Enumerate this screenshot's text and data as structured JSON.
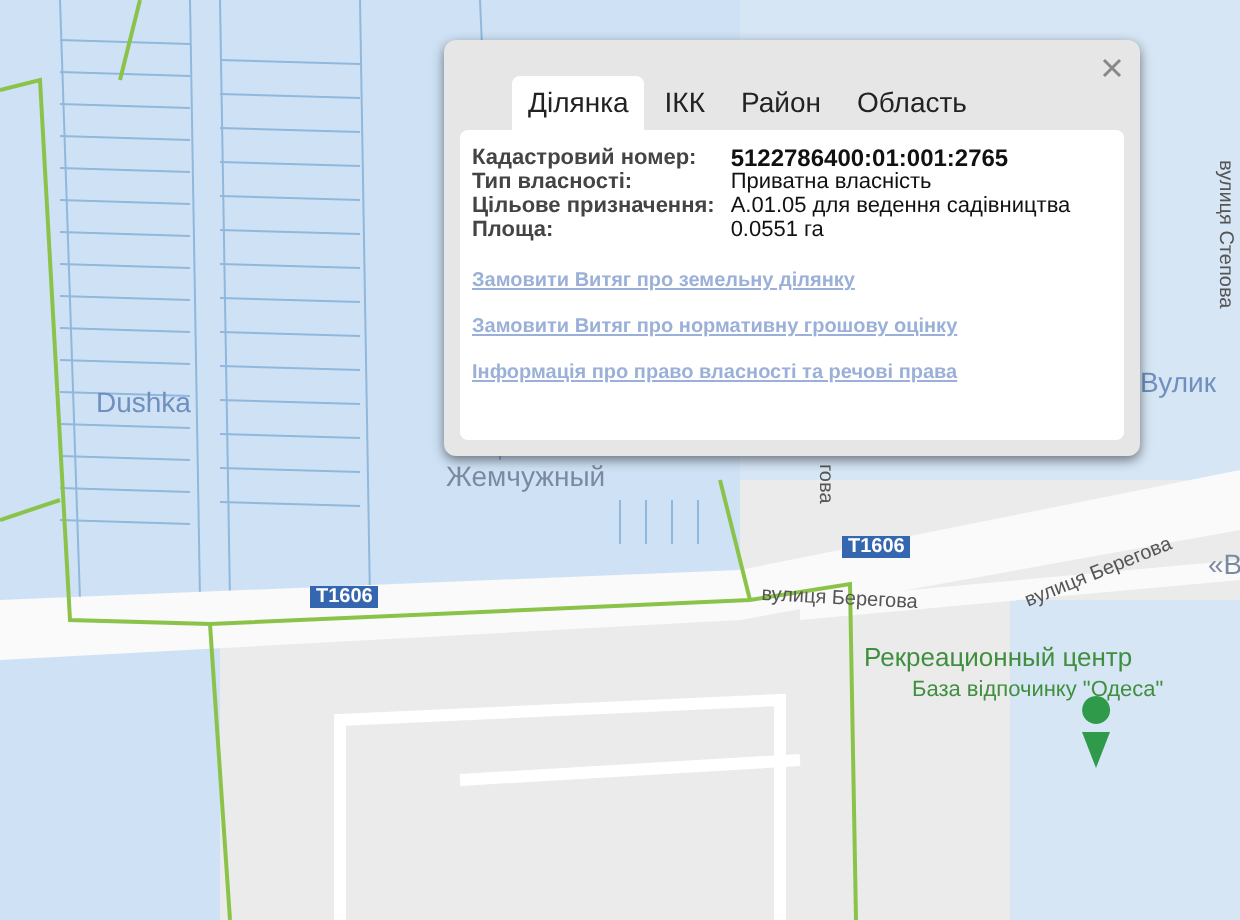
{
  "map": {
    "labels": [
      {
        "kind": "poi",
        "text": "Dushka"
      },
      {
        "kind": "place",
        "text": "Жемчужный"
      },
      {
        "kind": "road",
        "text": "T1606"
      },
      {
        "kind": "road",
        "text": "T1606"
      },
      {
        "kind": "street",
        "text": "вулиця Берегова"
      },
      {
        "kind": "street",
        "text": "вулиця Берегова"
      },
      {
        "kind": "street",
        "text": "гова"
      },
      {
        "kind": "street",
        "text": "вулиця Степова"
      },
      {
        "kind": "poi",
        "text": "Вулик"
      },
      {
        "kind": "place",
        "text": "«В"
      },
      {
        "kind": "green",
        "text": "Рекреационный центр"
      },
      {
        "kind": "greensmall",
        "text": "База відпочинку \"Одеса\""
      }
    ]
  },
  "popup": {
    "tabs": [
      {
        "label": "Ділянка",
        "selected": true
      },
      {
        "label": "ІКК",
        "selected": false
      },
      {
        "label": "Район",
        "selected": false
      },
      {
        "label": "Область",
        "selected": false
      }
    ],
    "fields": [
      {
        "label": "Кадастровий номер:",
        "value": "5122786400:01:001:2765",
        "bold": true
      },
      {
        "label": "Тип власності:",
        "value": "Приватна власність",
        "bold": false
      },
      {
        "label": "Цільове призначення:",
        "value": "А.01.05 для ведення садівництва",
        "bold": false
      },
      {
        "label": "Площа:",
        "value": "0.0551 га",
        "bold": false
      }
    ],
    "links": [
      "Замовити Витяг про земельну ділянку",
      "Замовити Витяг про нормативну грошову оцінку",
      "Інформація про право власності та речові права"
    ]
  }
}
